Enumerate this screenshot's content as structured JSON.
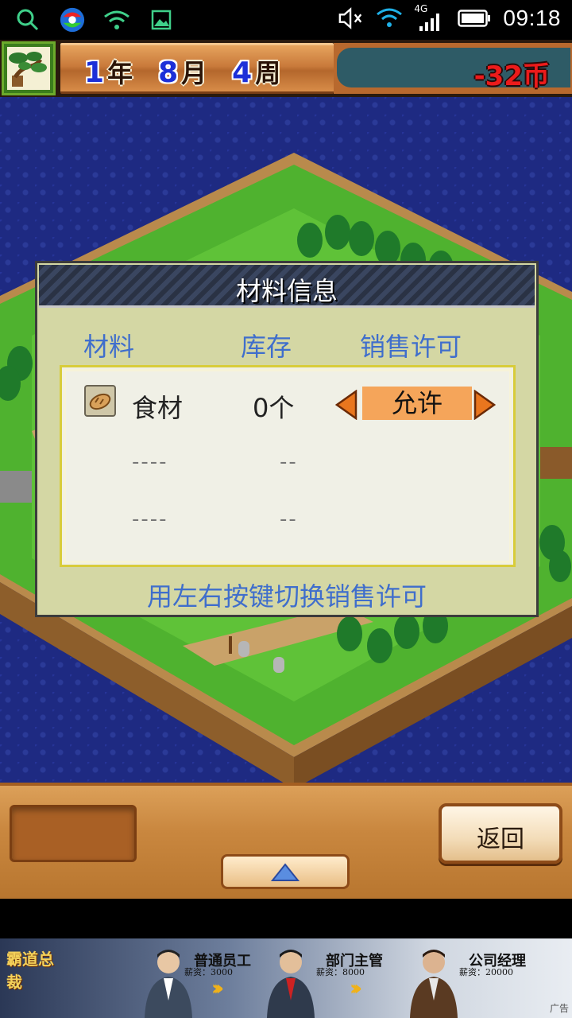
{
  "status_bar": {
    "time": "09:18",
    "network": "4G",
    "icons": [
      "search-icon",
      "app-icon",
      "wifi-icon",
      "gallery-icon",
      "mute-icon",
      "wifi-icon",
      "signal-icon",
      "battery-icon"
    ]
  },
  "header": {
    "year_num": "1",
    "year_unit": "年",
    "month_num": "8",
    "month_unit": "月",
    "week_num": "4",
    "week_unit": "周",
    "money": "-32币",
    "badge_icon": "bonsai-tree-icon"
  },
  "dialog": {
    "title": "材料信息",
    "columns": [
      "材料",
      "库存",
      "销售许可"
    ],
    "rows": [
      {
        "name": "食材",
        "stock": "0个",
        "permit": "允许",
        "icon": "food-bread-icon"
      },
      {
        "name": "----",
        "stock": "--"
      },
      {
        "name": "----",
        "stock": "--"
      }
    ],
    "hint": "用左右按键切换销售许可"
  },
  "toolbar": {
    "back_label": "返回",
    "up_icon": "up-arrow-icon"
  },
  "ad": {
    "logo": "霸道总裁",
    "roles": [
      {
        "title": "普通员工",
        "pay": "薪资：3000"
      },
      {
        "title": "部门主管",
        "pay": "薪资：8000"
      },
      {
        "title": "公司经理",
        "pay": "薪资：20000"
      }
    ],
    "tag": "广告"
  },
  "colors": {
    "accent_blue": "#3f6ecc",
    "permit_orange": "#f5a55a",
    "money_red": "#ec1b1b",
    "sea_blue": "#1e2a82"
  }
}
